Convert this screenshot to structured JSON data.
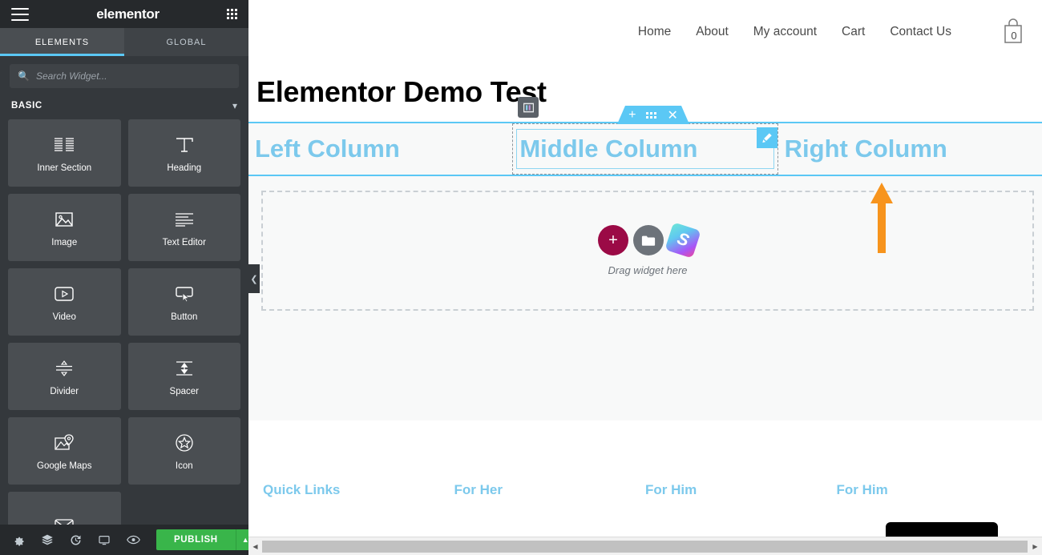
{
  "panel": {
    "logo": "elementor",
    "menu_icon": "hamburger-icon",
    "apps_icon": "grid-apps-icon",
    "tabs": [
      {
        "label": "ELEMENTS",
        "active": true
      },
      {
        "label": "GLOBAL",
        "active": false
      }
    ],
    "search": {
      "placeholder": "Search Widget...",
      "value": "",
      "icon": "search-icon"
    },
    "category": {
      "label": "BASIC",
      "chevron": "chevron-down-icon",
      "expanded": true
    },
    "widgets": [
      {
        "label": "Inner Section",
        "icon": "inner-section-icon"
      },
      {
        "label": "Heading",
        "icon": "heading-t-icon"
      },
      {
        "label": "Image",
        "icon": "image-icon"
      },
      {
        "label": "Text Editor",
        "icon": "text-editor-icon"
      },
      {
        "label": "Video",
        "icon": "video-play-icon"
      },
      {
        "label": "Button",
        "icon": "button-cursor-icon"
      },
      {
        "label": "Divider",
        "icon": "divider-icon"
      },
      {
        "label": "Spacer",
        "icon": "spacer-icon"
      },
      {
        "label": "Google Maps",
        "icon": "google-maps-pin-icon"
      },
      {
        "label": "Icon",
        "icon": "star-circle-icon"
      }
    ],
    "footer": {
      "icons": [
        {
          "name": "settings-gear-icon"
        },
        {
          "name": "navigator-layers-icon"
        },
        {
          "name": "history-icon"
        },
        {
          "name": "responsive-monitor-icon"
        },
        {
          "name": "preview-eye-icon"
        }
      ],
      "publish_label": "PUBLISH",
      "publish_arrow": "chevron-up-icon",
      "publish_color": "#39b54a"
    },
    "collapse_handle": "chevron-left-icon"
  },
  "preview": {
    "nav": [
      {
        "label": "Home"
      },
      {
        "label": "About"
      },
      {
        "label": "My account"
      },
      {
        "label": "Cart"
      },
      {
        "label": "Contact Us"
      }
    ],
    "cart": {
      "icon": "shopping-bag-icon",
      "count": "0"
    },
    "page_title": "Elementor Demo Test",
    "section": {
      "toolbar": {
        "add": "plus-icon",
        "drag": "drag-dots-icon",
        "delete": "close-x-icon",
        "color": "#5bc8f5"
      },
      "columns": [
        {
          "text": "Left Column",
          "selected": false
        },
        {
          "text": "Middle Column",
          "selected": true
        },
        {
          "text": "Right Column",
          "selected": false
        }
      ],
      "column_handle_icon": "column-layout-icon",
      "column_edit_icon": "pencil-edit-icon"
    },
    "annotation": {
      "type": "arrow-up",
      "color": "#f7941d"
    },
    "drop_zone": {
      "label": "Drag widget here",
      "add_widget_icon": "plus-icon",
      "template_icon": "folder-icon",
      "third_party_icon": "sl-logo-icon"
    },
    "footer_columns": [
      {
        "heading": "Quick Links"
      },
      {
        "heading": "For Her"
      },
      {
        "heading": "For Him"
      },
      {
        "heading": "For Him"
      }
    ],
    "scrollbar": {
      "left_arrow": "chevron-left-icon",
      "right_arrow": "chevron-right-icon"
    }
  }
}
